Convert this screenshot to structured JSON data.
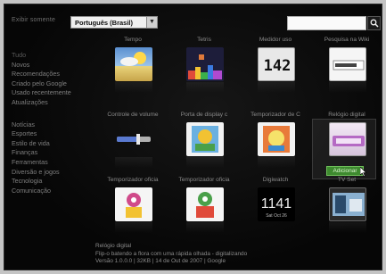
{
  "topbar": {
    "lang_label": "Exibir somente",
    "lang_value": "Português (Brasil)",
    "search_placeholder": ""
  },
  "sidebar": {
    "items": [
      "Tudo",
      "Novos",
      "Recomendações",
      "Criado pelo Google",
      "Usado recentemente",
      "Atualizações",
      "Notícias",
      "Esportes",
      "Estilo de vida",
      "Finanças",
      "Ferramentas",
      "Diversão e jogos",
      "Tecnologia",
      "Comunicação"
    ]
  },
  "gadgets": [
    {
      "name": "Tempo",
      "icon": "weather-icon"
    },
    {
      "name": "Tetris",
      "icon": "tetris-icon"
    },
    {
      "name": "Medidor uso",
      "icon": "meter-icon"
    },
    {
      "name": "Pesquisa na Wiki",
      "icon": "wiki-icon"
    },
    {
      "name": "Controle de volume",
      "icon": "volume-icon"
    },
    {
      "name": "Porta de display c",
      "icon": "display-icon"
    },
    {
      "name": "Temporizador de C",
      "icon": "timer-icon"
    },
    {
      "name": "Relógio digital",
      "icon": "digital-clock-icon"
    },
    {
      "name": "Temporizador oficia",
      "icon": "timer2-icon"
    },
    {
      "name": "Temporizador oficia",
      "icon": "timer3-icon"
    },
    {
      "name": "Digiwatch",
      "icon": "digiwatch-icon"
    },
    {
      "name": "TV Set",
      "icon": "tv-icon"
    }
  ],
  "meter_digits": "142",
  "digiwatch": {
    "time": "1141",
    "date": "Sat Oct 26"
  },
  "add_label": "Adicionar",
  "footer": {
    "title": "Relógio digital",
    "description": "Flip-o batendo a flora com uma rápida olhada - digitalizando",
    "version": "Versão 1.0.0.0 | 32KB | 14 de Out de 2007 | Google"
  }
}
